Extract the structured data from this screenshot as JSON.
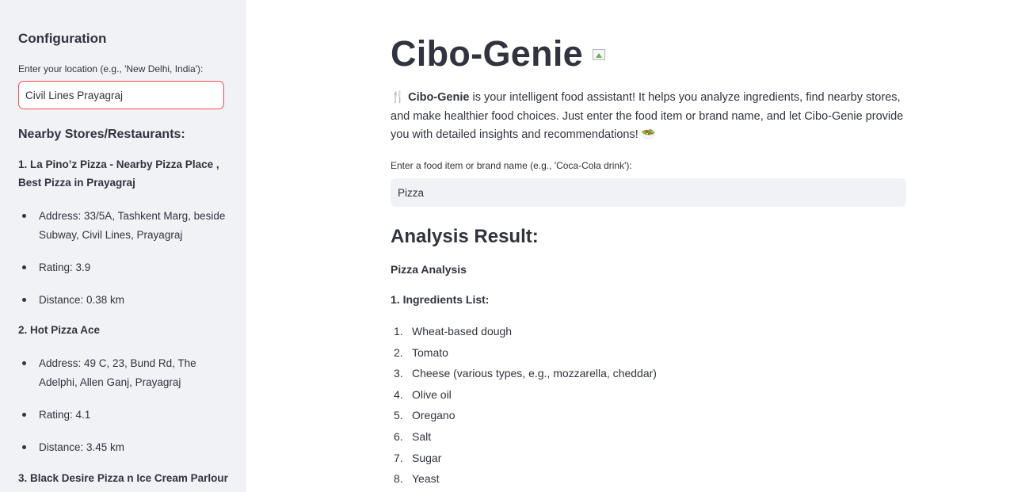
{
  "sidebar": {
    "title": "Configuration",
    "location_label": "Enter your location (e.g., 'New Delhi, India'):",
    "location_value": "Civil Lines Prayagraj",
    "stores_heading": "Nearby Stores/Restaurants:",
    "stores": [
      {
        "name": "1. La Pino’z Pizza - Nearby Pizza Place , Best Pizza in Prayagraj",
        "address": "Address: 33/5A, Tashkent Marg, beside Subway, Civil Lines, Prayagraj",
        "rating": "Rating: 3.9",
        "distance": "Distance: 0.38 km"
      },
      {
        "name": "2. Hot Pizza Ace",
        "address": "Address: 49 C, 23, Bund Rd, The Adelphi, Allen Ganj, Prayagraj",
        "rating": "Rating: 4.1",
        "distance": "Distance: 3.45 km"
      },
      {
        "name": "3. Black Desire Pizza n Ice Cream Parlour"
      }
    ]
  },
  "main": {
    "title": "Cibo-Genie",
    "intro_icon": "🍴",
    "intro_bold": "Cibo-Genie",
    "intro_text": " is your intelligent food assistant! It helps you analyze ingredients, find nearby stores, and make healthier food choices. Just enter the food item or brand name, and let Cibo-Genie provide you with detailed insights and recommendations! ",
    "intro_end_icon": "🥗",
    "food_label": "Enter a food item or brand name (e.g., 'Coca-Cola drink'):",
    "food_value": "Pizza",
    "result_heading": "Analysis Result:",
    "analysis_title": "Pizza Analysis",
    "ingredients_title": "1. Ingredients List:",
    "ingredients": [
      {
        "num": "1.",
        "text": "Wheat-based dough"
      },
      {
        "num": "2.",
        "text": "Tomato"
      },
      {
        "num": "3.",
        "text": "Cheese (various types, e.g., mozzarella, cheddar)"
      },
      {
        "num": "4.",
        "text": "Olive oil"
      },
      {
        "num": "5.",
        "text": "Oregano"
      },
      {
        "num": "6.",
        "text": "Salt"
      },
      {
        "num": "7.",
        "text": "Sugar"
      },
      {
        "num": "8.",
        "text": "Yeast"
      }
    ]
  },
  "colors": {
    "sidebar_bg": "#f0f2f6",
    "text": "#31333f",
    "focus_border": "#ff4b4b"
  }
}
